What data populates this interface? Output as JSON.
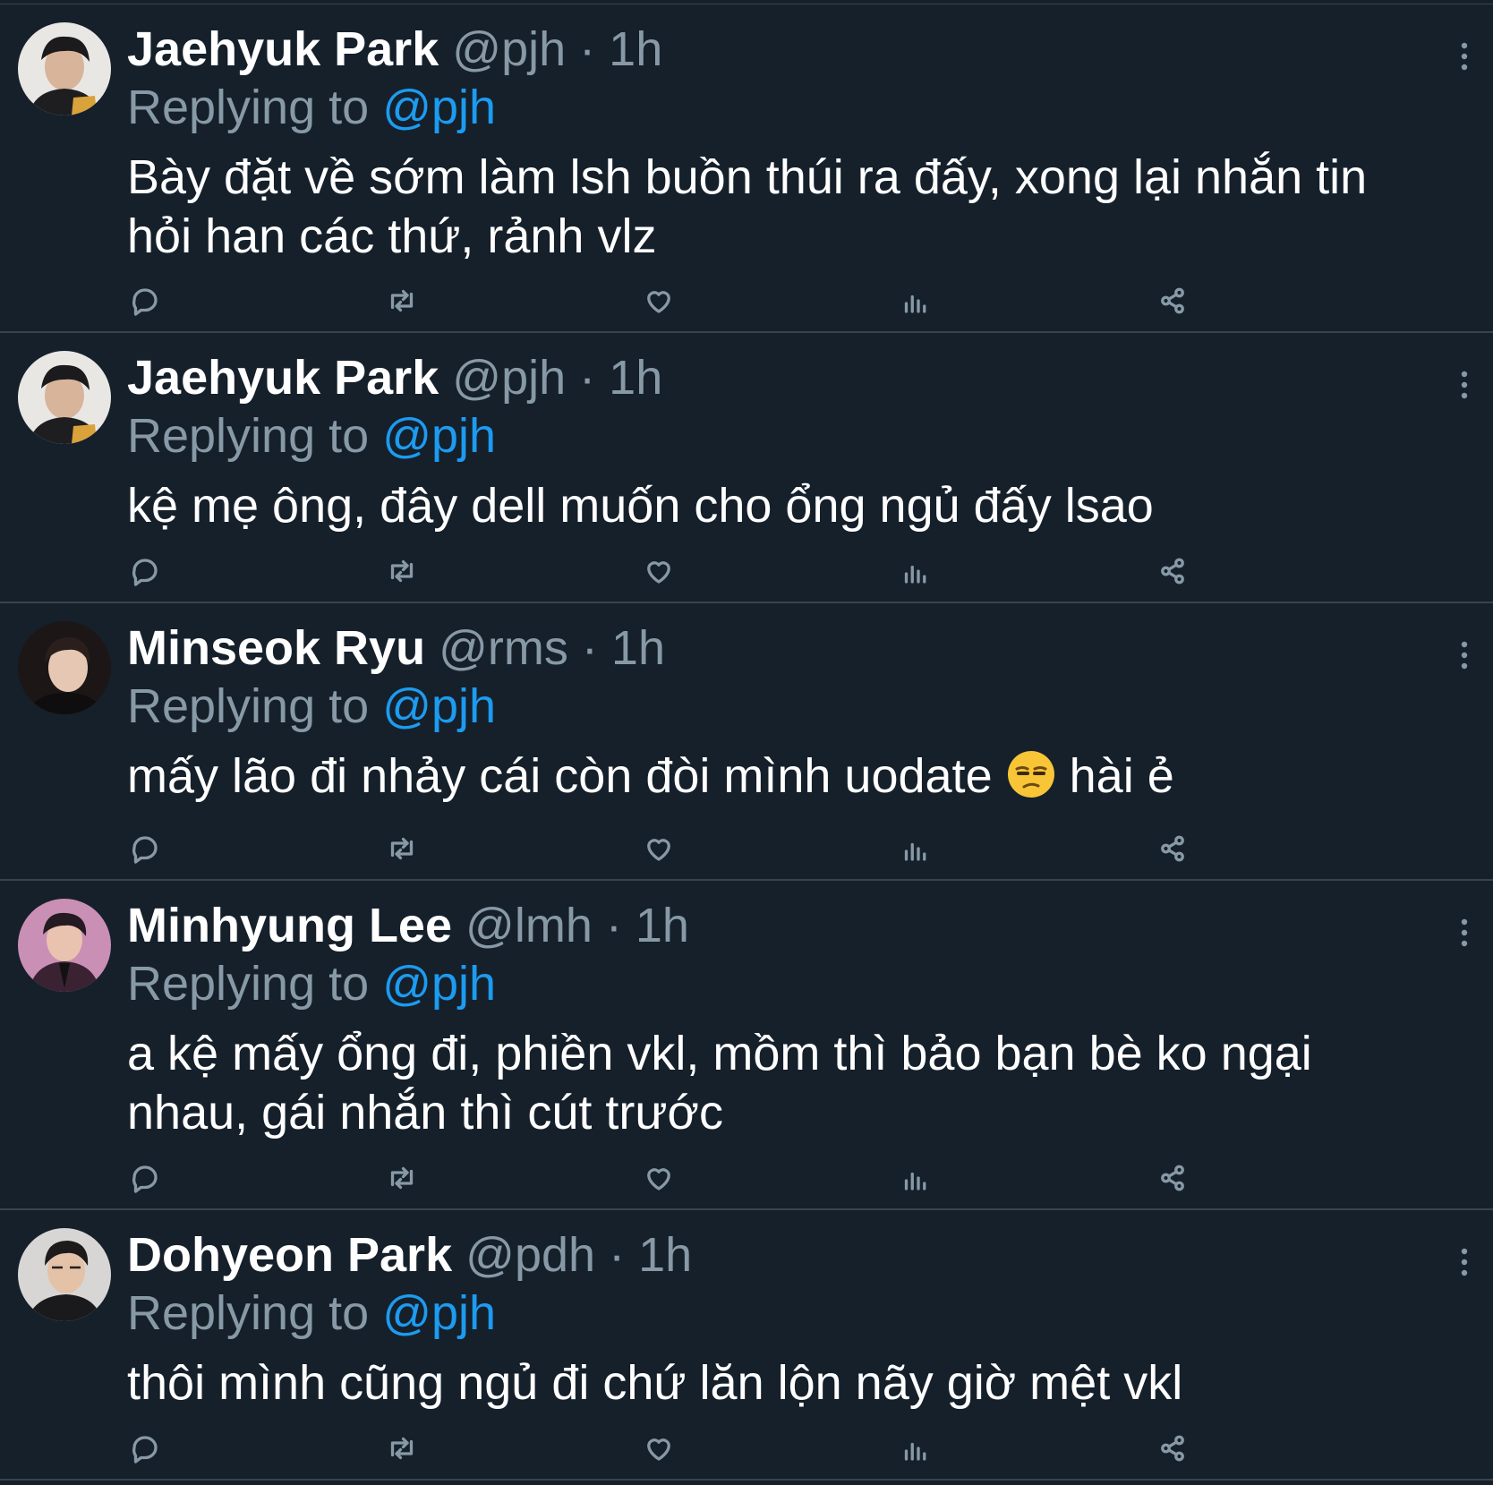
{
  "tweets": [
    {
      "name": "Jaehyuk Park",
      "handle": "@pjh",
      "separator": "·",
      "time": "1h",
      "replying_prefix": "Replying to",
      "replying_to": "@pjh",
      "text": "Bày đặt về sớm làm lsh buồn thúi ra đấy, xong lại nhắn tin hỏi han các thứ, rảnh vlz"
    },
    {
      "name": "Jaehyuk Park",
      "handle": "@pjh",
      "separator": "·",
      "time": "1h",
      "replying_prefix": "Replying to",
      "replying_to": "@pjh",
      "text": "kệ mẹ ông, đây dell muốn cho ổng ngủ đấy lsao"
    },
    {
      "name": "Minseok Ryu",
      "handle": "@rms",
      "separator": "·",
      "time": "1h",
      "replying_prefix": "Replying to",
      "replying_to": "@pjh",
      "text": "mấy lão đi nhảy cái còn đòi mình uodate",
      "text_after_emoji": " hài ẻ",
      "emoji": "unamused-face"
    },
    {
      "name": "Minhyung Lee",
      "handle": "@lmh",
      "separator": "·",
      "time": "1h",
      "replying_prefix": "Replying to",
      "replying_to": "@pjh",
      "text": "a kệ mấy ổng đi, phiền vkl, mồm thì bảo bạn bè ko ngại nhau, gái nhắn thì cút trước"
    },
    {
      "name": "Dohyeon Park",
      "handle": "@pdh",
      "separator": "·",
      "time": "1h",
      "replying_prefix": "Replying to",
      "replying_to": "@pjh",
      "text": "thôi mình cũng ngủ đi chứ lăn lộn nãy giờ mệt vkl"
    }
  ],
  "icons": {
    "reply": "reply-icon",
    "retweet": "retweet-icon",
    "like": "heart-icon",
    "views": "analytics-icon",
    "share": "share-icon",
    "more": "more-vertical-icon"
  },
  "colors": {
    "background": "#15202b",
    "divider": "#38444d",
    "muted": "#8899a6",
    "link": "#1d9bf0",
    "text": "#ffffff"
  }
}
